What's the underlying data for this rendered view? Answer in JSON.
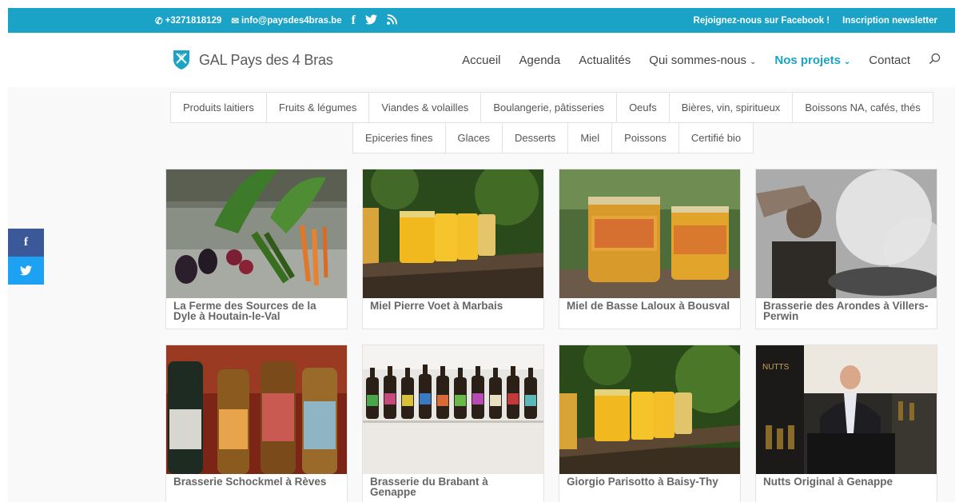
{
  "topbar": {
    "phone": "+3271818129",
    "email": "info@paysdes4bras.be",
    "facebook_link": "Rejoignez-nous sur Facebook !",
    "newsletter_link": "Inscription newsletter"
  },
  "header": {
    "logo_text": "GAL Pays des 4 Bras",
    "nav": {
      "accueil": "Accueil",
      "agenda": "Agenda",
      "actualites": "Actualités",
      "qui": "Qui sommes-nous",
      "projets": "Nos projets",
      "contact": "Contact"
    }
  },
  "categories": {
    "row1": [
      "Produits laitiers",
      "Fruits & légumes",
      "Viandes & volailles",
      "Boulangerie, pâtisseries",
      "Oeufs",
      "Bières, vin, spiritueux",
      "Boissons NA, cafés, thés"
    ],
    "row2": [
      "Epiceries fines",
      "Glaces",
      "Desserts",
      "Miel",
      "Poissons",
      "Certifié bio"
    ]
  },
  "products": [
    {
      "title": "La Ferme des Sources de la Dyle à Houtain-le-Val",
      "image": "vegetables-image"
    },
    {
      "title": "Miel Pierre Voet à Marbais",
      "image": "honey-jars-image"
    },
    {
      "title": "Miel de Basse Laloux à Bousval",
      "image": "honey-labels-image"
    },
    {
      "title": "Brasserie des Arondes à Villers-Perwin",
      "image": "brewer-steam-image"
    },
    {
      "title": "Brasserie Schockmel à Rèves",
      "image": "beer-bottles-image"
    },
    {
      "title": "Brasserie du Brabant à Genappe",
      "image": "bottle-row-image"
    },
    {
      "title": "Giorgio Parisotto à Baisy-Thy",
      "image": "honey-table-image"
    },
    {
      "title": "Nutts Original à Genappe",
      "image": "stand-man-image"
    }
  ],
  "share": {
    "facebook": "f",
    "twitter": "t"
  },
  "colors": {
    "accent": "#1aa3c7",
    "facebook": "#3b5998",
    "twitter": "#1da1f2"
  }
}
